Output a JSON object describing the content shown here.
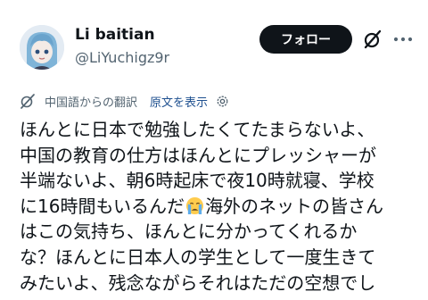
{
  "user": {
    "display_name": "Li baitian",
    "handle": "@LiYuchigz9r",
    "avatar": "anime-girl-avatar"
  },
  "header": {
    "follow_label": "フォロー",
    "icons": [
      "grok-icon",
      "more-icon"
    ]
  },
  "translation": {
    "note": "中国語からの翻訳",
    "show_original_label": "原文を表示",
    "icons": [
      "translate-icon",
      "gear-icon"
    ]
  },
  "tweet": {
    "lines": [
      "ほんとに日本で勉強したくてたまらないよ、",
      "中国の教育の仕方はほんとにプレッシャーが",
      "半端ないよ、朝6時起床で夜10時就寝、学校",
      "に16時間もいるんだ",
      "海外のネットの皆さん",
      "はこの気持ち、ほんとに分かってくれるか",
      "な？ほんとに日本人の学生として一度生きて",
      "みたいよ、残念ながらそれはただの空想でし"
    ],
    "emoji": "crying-face-emoji"
  },
  "colors": {
    "text": "#0f1419",
    "secondary": "#536471",
    "link": "#1d4f8f",
    "button_bg": "#0f1419",
    "button_text": "#ffffff"
  }
}
